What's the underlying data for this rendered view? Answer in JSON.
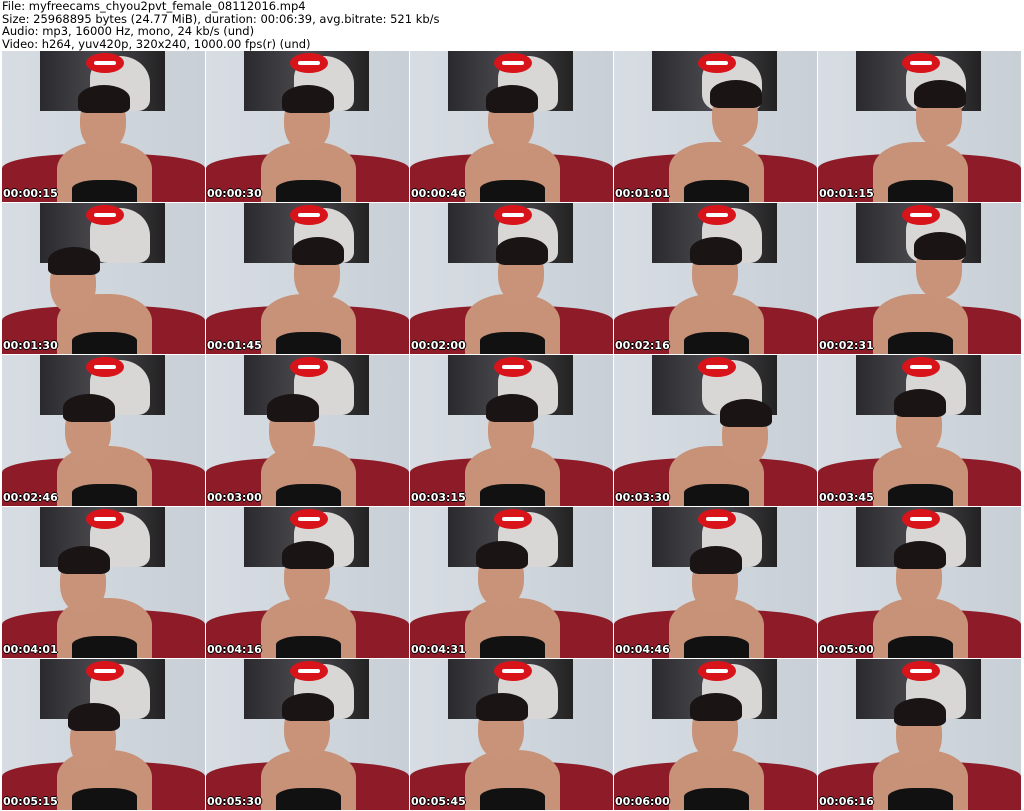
{
  "header": {
    "file": "File: myfreecams_chyou2pvt_female_08112016.mp4",
    "size": "Size: 25968895 bytes (24.77 MiB), duration: 00:06:39, avg.bitrate: 521 kb/s",
    "audio": "Audio: mp3, 16000 Hz, mono, 24 kb/s (und)",
    "video": "Video: h264, yuv420p, 320x240, 1000.00 fps(r) (und)"
  },
  "timestamps": [
    "00:00:15",
    "00:00:30",
    "00:00:46",
    "00:01:01",
    "00:01:15",
    "00:01:30",
    "00:01:45",
    "00:02:00",
    "00:02:16",
    "00:02:31",
    "00:02:46",
    "00:03:00",
    "00:03:15",
    "00:03:30",
    "00:03:45",
    "00:04:01",
    "00:04:16",
    "00:04:31",
    "00:04:46",
    "00:05:00",
    "00:05:15",
    "00:05:30",
    "00:05:45",
    "00:06:00",
    "00:06:16"
  ]
}
